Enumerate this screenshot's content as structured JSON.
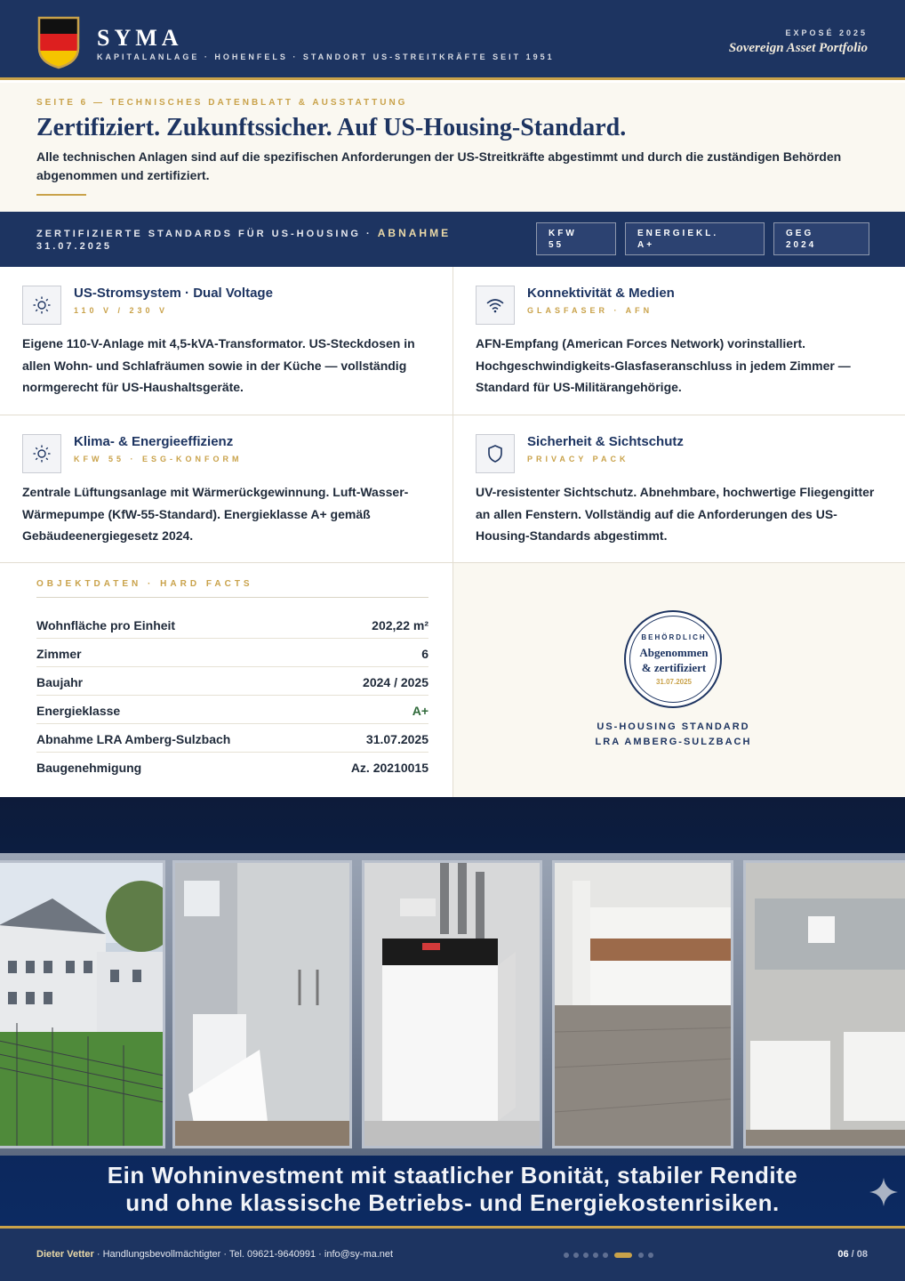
{
  "header": {
    "brand": "SYMA",
    "brand_sub": "KAPITALANLAGE · HOHENFELS · STANDORT US-STREITKRÄFTE SEIT 1951",
    "expose": "EXPOSÉ 2025",
    "portfolio": "Sovereign Asset Portfolio",
    "flag_colors": [
      "#111111",
      "#dd1f1f",
      "#f5c400"
    ]
  },
  "intro": {
    "kicker": "SEITE 6 — TECHNISCHES DATENBLATT & AUSSTATTUNG",
    "title": "Zertifiziert. Zukunftssicher. Auf US-Housing-Standard.",
    "lead": "Alle technischen Anlagen sind auf die spezifischen Anforderungen der US-Streitkräfte abgestimmt und durch die zuständigen Behörden abgenommen und zertifiziert."
  },
  "band": {
    "text": "ZERTIFIZIERTE STANDARDS FÜR US-HOUSING ·",
    "accent": "ABNAHME",
    "date": "31.07.2025",
    "pills": [
      {
        "line1": "KFW",
        "line2": "55"
      },
      {
        "line1": "ENERGIEKL.",
        "line2": "A+"
      },
      {
        "line1": "GEG",
        "line2": "2024"
      }
    ]
  },
  "features": [
    {
      "title": "US-Stromsystem · Dual Voltage",
      "sub": "110 V / 230 V",
      "icon": "sun-icon",
      "body": "Eigene 110-V-Anlage mit 4,5-kVA-Transformator. US-Steckdosen in allen Wohn- und Schlafräumen sowie in der Küche — vollständig normgerecht für US-Haushaltsgeräte."
    },
    {
      "title": "Konnektivität & Medien",
      "sub": "GLASFASER · AFN",
      "icon": "wifi-icon",
      "body": "AFN-Empfang (American Forces Network) vorinstalliert. Hochgeschwindigkeits-Glasfaseranschluss in jedem Zimmer — Standard für US-Militärangehörige."
    },
    {
      "title": "Klima- & Energieeffizienz",
      "sub": "KFW 55 · ESG-KONFORM",
      "icon": "sun-icon",
      "body": "Zentrale Lüftungsanlage mit Wärmerückgewinnung. Luft-Wasser-Wärmepumpe (KfW-55-Standard). Energieklasse A+ gemäß Gebäudeenergiegesetz 2024."
    },
    {
      "title": "Sicherheit & Sichtschutz",
      "sub": "PRIVACY PACK",
      "icon": "shield-icon",
      "body": "UV-resistenter Sichtschutz. Abnehmbare, hochwertige Fliegengitter an allen Fenstern. Vollständig auf die Anforderungen des US-Housing-Standards abgestimmt."
    }
  ],
  "facts": {
    "kicker": "OBJEKTDATEN · HARD FACTS",
    "rows": [
      {
        "label": "Wohnfläche pro Einheit",
        "value": "202,22 m²"
      },
      {
        "label": "Zimmer",
        "value": "6"
      },
      {
        "label": "Baujahr",
        "value": "2024 / 2025"
      },
      {
        "label": "Energieklasse",
        "value": "A+"
      },
      {
        "label": "Abnahme LRA Amberg-Sulzbach",
        "value": "31.07.2025"
      },
      {
        "label": "Baugenehmigung",
        "value": "Az. 20210015"
      }
    ]
  },
  "seal": {
    "top": "BEHÖRDLICH",
    "line1": "Abgenommen",
    "line2": "& zertifiziert",
    "date": "31.07.2025",
    "caption1": "US-HOUSING STANDARD",
    "caption2": "LRA AMBERG-SULZBACH"
  },
  "banner": {
    "line1": "Ein Wohninvestment mit staatlicher Bonität, stabiler Rendite",
    "line2": "und ohne klassische Betriebs- und Energiekostenrisiken."
  },
  "footer": {
    "name": "Dieter Vetter",
    "rest": " · Handlungsbevollmächtigter · Tel. 09621-9640991 · info@sy-ma.net",
    "page_current": "06",
    "page_sep": " / ",
    "page_total": "08",
    "dots_total": 9,
    "dots_active": 6
  }
}
